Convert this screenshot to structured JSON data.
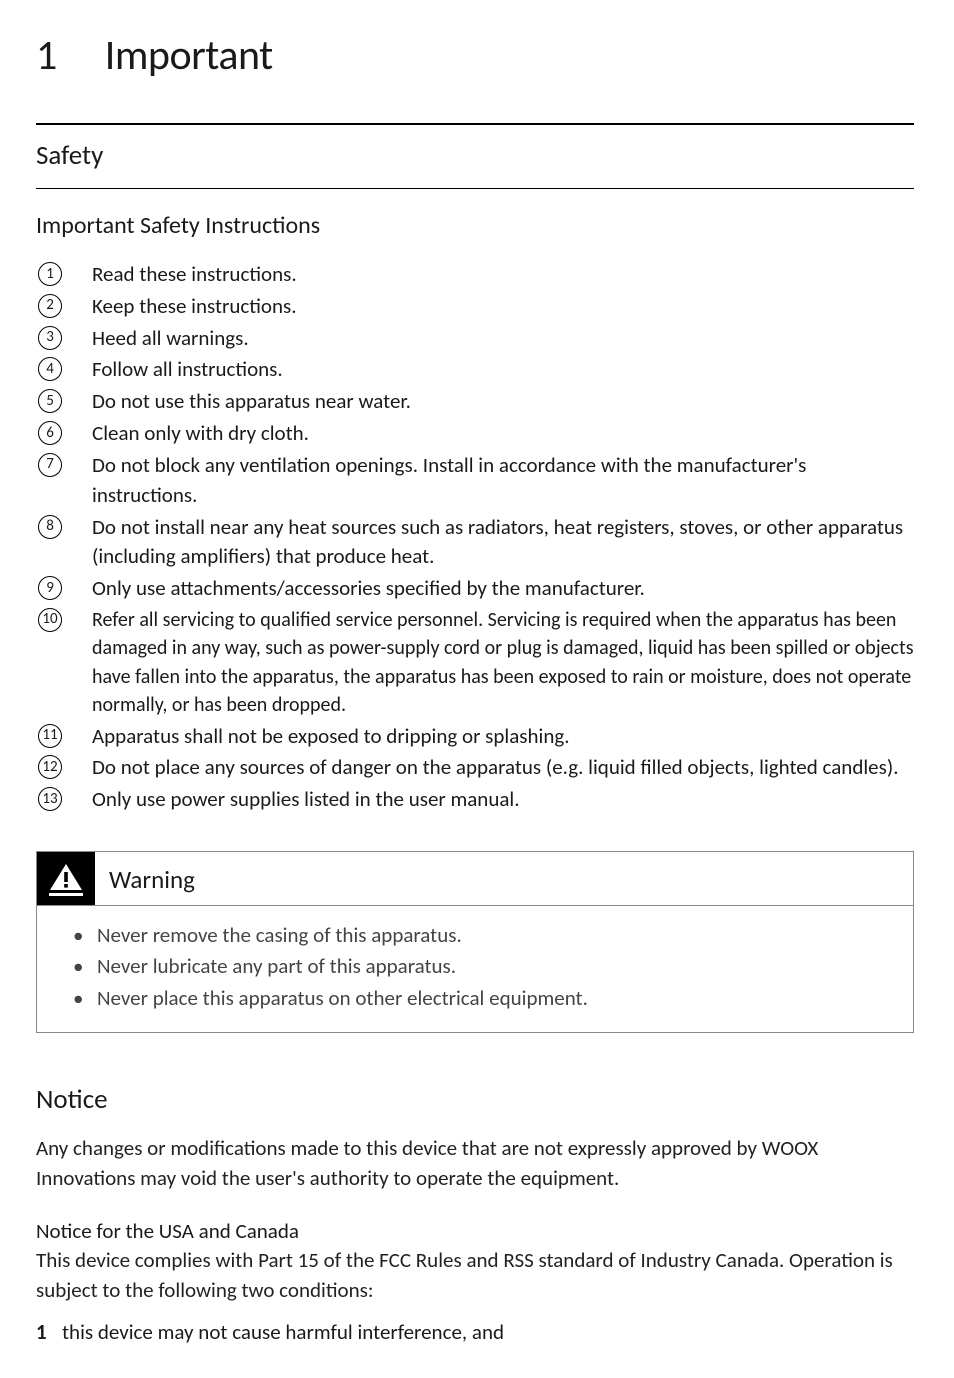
{
  "chapter": {
    "number": "1",
    "title": "Important"
  },
  "safety": {
    "heading": "Safety",
    "instructions_title": "Important Safety Instructions",
    "items": [
      "Read these instructions.",
      "Keep these instructions.",
      "Heed all warnings.",
      "Follow all instructions.",
      "Do not use this apparatus near water.",
      "Clean only with dry cloth.",
      "Do not block any ventilation openings. Install in accordance with the manufacturer's instructions.",
      "Do not install near any heat sources such as radiators, heat registers, stoves, or other apparatus (including amplifiers) that produce heat.",
      "Only use attachments/accessories specified by the manufacturer.",
      "Refer all servicing to qualified service personnel. Servicing is required when the apparatus has been damaged in any way, such as power-supply cord or plug is damaged, liquid has been spilled or objects have fallen into the apparatus, the apparatus has been exposed to rain or moisture, does not operate normally, or has been dropped.",
      "Apparatus shall not be exposed to dripping or splashing.",
      "Do not place any sources of danger on the apparatus (e.g. liquid filled objects, lighted candles).",
      "Only use power supplies listed in the user manual."
    ]
  },
  "warning": {
    "label": "Warning",
    "bullets": [
      "Never remove the casing of this apparatus.",
      "Never lubricate any part of this apparatus.",
      "Never place this apparatus on other electrical equipment."
    ]
  },
  "notice": {
    "heading": "Notice",
    "intro": "Any changes or modifications made to this device that are not expressly approved by WOOX Innovations may void the user's authority to operate the equipment.",
    "usa_canada_heading": "Notice for the USA and Canada",
    "usa_canada_body": "This device complies with Part 15 of the FCC Rules and RSS standard of Industry Canada. Operation is subject to the following two conditions:",
    "conditions": [
      {
        "num": "1",
        "text": "this device may not cause harmful interference, and"
      }
    ]
  }
}
